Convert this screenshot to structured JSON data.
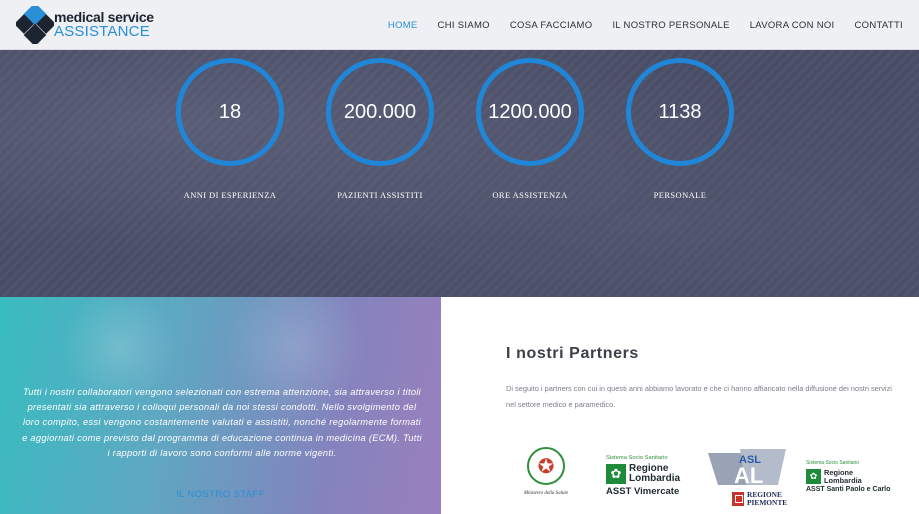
{
  "header": {
    "logo": {
      "line1": "medical service",
      "line2": "ASSISTANCE",
      "icon": "diamond-cross-logo",
      "colors": {
        "dark": "#1c2430",
        "blue": "#2a8fd6"
      }
    },
    "nav": [
      {
        "label": "HOME",
        "active": true
      },
      {
        "label": "CHI SIAMO",
        "active": false
      },
      {
        "label": "COSA FACCIAMO",
        "active": false
      },
      {
        "label": "IL NOSTRO PERSONALE",
        "active": false
      },
      {
        "label": "LAVORA CON NOI",
        "active": false
      },
      {
        "label": "CONTATTI",
        "active": false
      }
    ]
  },
  "stats": [
    {
      "value": "18",
      "label": "ANNI DI ESPERIENZA"
    },
    {
      "value": "200.000",
      "label": "PAZIENTI ASSISTITI"
    },
    {
      "value": "1200.000",
      "label": "ORE ASSISTENZA"
    },
    {
      "value": "1138",
      "label": "PERSONALE"
    }
  ],
  "promo": {
    "text": "Tutti i nostri collaboratori vengono selezionati con estrema attenzione, sia attraverso i titoli presentati sia attraverso i colloqui personali da noi stessi condotti. Nello svolgimento del loro compito, essi vengono costantemente valutati e assistiti, nonché regolarmente formati e aggiornati come previsto dal programma di educazione continua in medicina (ECM). Tutti i rapporti di lavoro sono conformi alle norme vigenti.",
    "link": "IL NOSTRO STAFF"
  },
  "partners": {
    "title": "I nostri Partners",
    "text": "Di seguito i partners con cui in questi anni abbiamo lavorato e che ci hanno affiancato nella diffusione dei nostri servizi nel settore medico e paramedico.",
    "logos": {
      "ministry": {
        "caption": "Ministero della Salute",
        "icon": "italian-emblem-icon"
      },
      "rl_vimercate": {
        "small": "Sistema Socio Sanitario",
        "name1": "Regione",
        "name2": "Lombardia",
        "asst": "ASST Vimercate",
        "icon": "lombardia-rose-icon"
      },
      "asl": {
        "badge": "ASL",
        "sub": "AL",
        "region1": "REGIONE",
        "region2": "PIEMONTE",
        "icon": "asl-al-logo"
      },
      "rl_santi": {
        "small": "Sistema Socio Sanitario",
        "name1": "Regione",
        "name2": "Lombardia",
        "asst": "ASST Santi Paolo e Carlo",
        "icon": "lombardia-rose-icon"
      }
    }
  },
  "colors": {
    "accent": "#2a8fd6",
    "ring": "#1f86d8",
    "band": "#4a4e67",
    "green": "#1f8a3a"
  }
}
